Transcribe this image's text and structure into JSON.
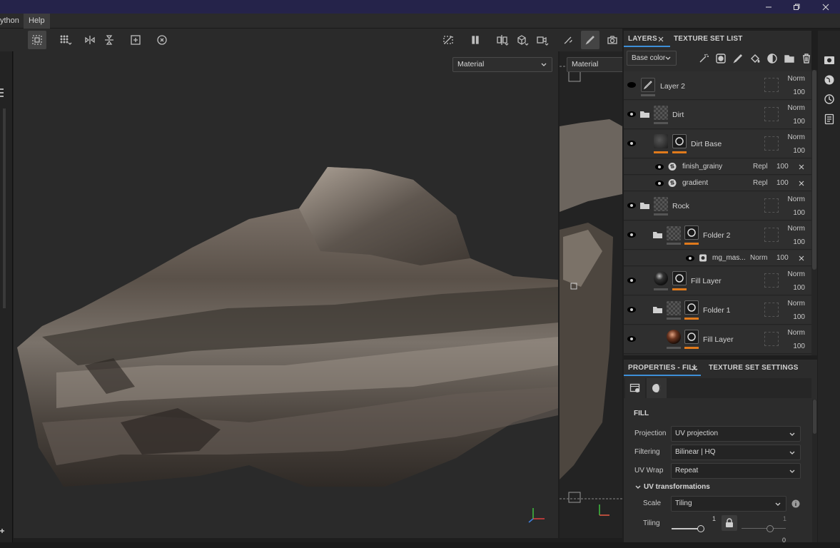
{
  "menubar": {
    "items": [
      "ython",
      "Help"
    ]
  },
  "viewport": {
    "left_mode": "Material",
    "right_mode": "Material"
  },
  "layers_panel": {
    "tabs": [
      "LAYERS",
      "TEXTURE SET LIST"
    ],
    "channel_select": "Base color",
    "layers": [
      {
        "name": "Layer 2",
        "blend": "Norm",
        "opacity": "100"
      },
      {
        "name": "Dirt",
        "blend": "Norm",
        "opacity": "100"
      },
      {
        "name": "Dirt Base",
        "blend": "Norm",
        "opacity": "100"
      },
      {
        "name": "finish_grainy",
        "blend": "Repl",
        "opacity": "100"
      },
      {
        "name": "gradient",
        "blend": "Repl",
        "opacity": "100"
      },
      {
        "name": "Rock",
        "blend": "Norm",
        "opacity": "100"
      },
      {
        "name": "Folder 2",
        "blend": "Norm",
        "opacity": "100"
      },
      {
        "name": "mg_mas...",
        "blend": "Norm",
        "opacity": "100"
      },
      {
        "name": "Fill Layer",
        "blend": "Norm",
        "opacity": "100"
      },
      {
        "name": "Folder 1",
        "blend": "Norm",
        "opacity": "100"
      },
      {
        "name": "Fill Layer",
        "blend": "Norm",
        "opacity": "100"
      }
    ]
  },
  "properties_panel": {
    "tabs": [
      "PROPERTIES - FILL",
      "TEXTURE SET SETTINGS"
    ],
    "section": "FILL",
    "fields": [
      {
        "label": "Projection",
        "value": "UV projection"
      },
      {
        "label": "Filtering",
        "value": "Bilinear | HQ"
      },
      {
        "label": "UV Wrap",
        "value": "Repeat"
      }
    ],
    "uv_section": "UV transformations",
    "scale": {
      "label": "Scale",
      "value": "Tiling"
    },
    "tiling": {
      "label": "Tiling",
      "value1": "1",
      "value2": "1",
      "value3": "0"
    }
  },
  "colors": {
    "accent": "#e07a1c",
    "titlebar": "#25234a",
    "panel": "#2c2c2c"
  }
}
